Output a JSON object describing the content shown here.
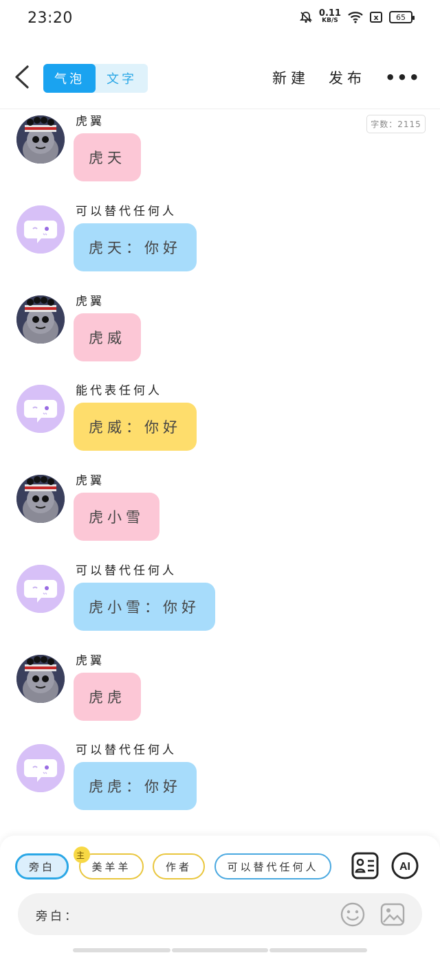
{
  "status": {
    "time": "23:20",
    "speed_value": "0.11",
    "speed_unit": "KB/S",
    "battery": "65",
    "sim_icon": "x"
  },
  "header": {
    "back_icon": "<",
    "tabs": [
      {
        "label": "气泡",
        "active": true
      },
      {
        "label": "文字",
        "active": false
      }
    ],
    "new_label": "新建",
    "publish_label": "发布",
    "more_label": "•••"
  },
  "word_count": "字数：2115",
  "messages": [
    {
      "name": "虎翼",
      "text": "虎天",
      "avatar": "character",
      "color": "pink"
    },
    {
      "name": "可以替代任何人",
      "text": "虎天：你好",
      "avatar": "speech-bubble",
      "color": "blue"
    },
    {
      "name": "虎翼",
      "text": "虎威",
      "avatar": "character",
      "color": "pink"
    },
    {
      "name": "能代表任何人",
      "text": "虎威：你好",
      "avatar": "speech-bubble",
      "color": "yellow"
    },
    {
      "name": "虎翼",
      "text": "虎小雪",
      "avatar": "character",
      "color": "pink"
    },
    {
      "name": "可以替代任何人",
      "text": "虎小雪：你好",
      "avatar": "speech-bubble",
      "color": "blue"
    },
    {
      "name": "虎翼",
      "text": "虎虎",
      "avatar": "character",
      "color": "pink"
    },
    {
      "name": "可以替代任何人",
      "text": "虎虎：你好",
      "avatar": "speech-bubble",
      "color": "blue"
    }
  ],
  "roles": [
    {
      "label": "旁白",
      "selected": true
    },
    {
      "label": "美羊羊",
      "badge": "主"
    },
    {
      "label": "作者"
    },
    {
      "label": "可以替代任何人"
    }
  ],
  "ai_label": "AI",
  "input": {
    "label": "旁白："
  },
  "colors": {
    "accent": "#1aa3f0",
    "pink": "#fcc7d6",
    "blue": "#a7dcfb",
    "yellow": "#fedd6c"
  }
}
